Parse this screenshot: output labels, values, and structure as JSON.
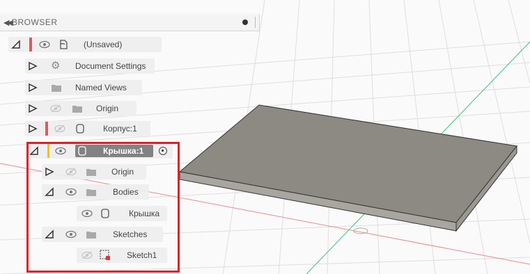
{
  "browser": {
    "title": "BROWSER",
    "collapse_icon": "double-chevron-left-icon",
    "pin_icon": "pin-dot-icon"
  },
  "tree": {
    "root": {
      "label": "(Unsaved)",
      "expanded": true,
      "icon": "component-icon"
    },
    "document_settings": {
      "label": "Document Settings",
      "icon": "gear-icon"
    },
    "named_views": {
      "label": "Named Views",
      "icon": "folder-icon"
    },
    "origin": {
      "label": "Origin",
      "icon": "folder-icon"
    },
    "korpus": {
      "label": "Корпус:1",
      "icon": "body-icon"
    },
    "kryshka": {
      "label": "Крышка:1",
      "icon": "body-icon",
      "active_icon": "radio-active-icon",
      "children": {
        "origin": {
          "label": "Origin"
        },
        "bodies": {
          "label": "Bodies"
        },
        "body_kryshka": {
          "label": "Крышка"
        },
        "sketches": {
          "label": "Sketches"
        },
        "sketch1": {
          "label": "Sketch1"
        }
      }
    }
  },
  "colors": {
    "highlight_box": "#e01f25",
    "active_chip": "#828282",
    "red_marker": "#e3575b",
    "yellow_marker": "#f0c000",
    "plate_top": "#8c8a82",
    "axis_green": "#3ec27a",
    "axis_red": "#e88a8a"
  }
}
